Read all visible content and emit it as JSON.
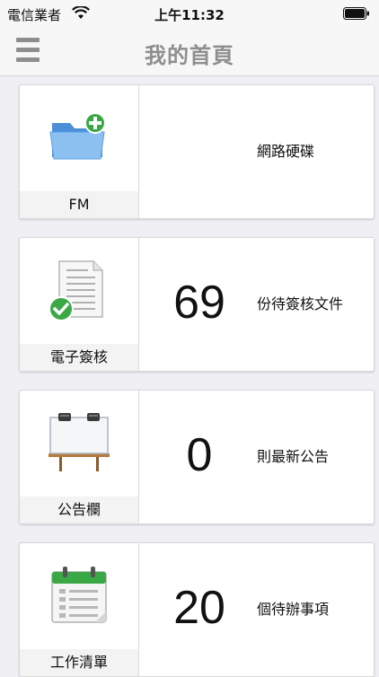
{
  "status": {
    "carrier": "電信業者",
    "time": "上午11:32"
  },
  "nav": {
    "title": "我的首頁"
  },
  "cards": [
    {
      "label": "FM",
      "count": "",
      "desc": "網路硬碟"
    },
    {
      "label": "電子簽核",
      "count": "69",
      "desc": "份待簽核文件"
    },
    {
      "label": "公告欄",
      "count": "0",
      "desc": "則最新公告"
    },
    {
      "label": "工作清單",
      "count": "20",
      "desc": "個待辦事項"
    }
  ],
  "colors": {
    "accent_green": "#3aa845",
    "folder_blue": "#6aa9e8",
    "board_brown": "#b37a3e"
  },
  "icons": [
    "folder-add-icon",
    "document-check-icon",
    "bulletin-board-icon",
    "calendar-list-icon"
  ]
}
